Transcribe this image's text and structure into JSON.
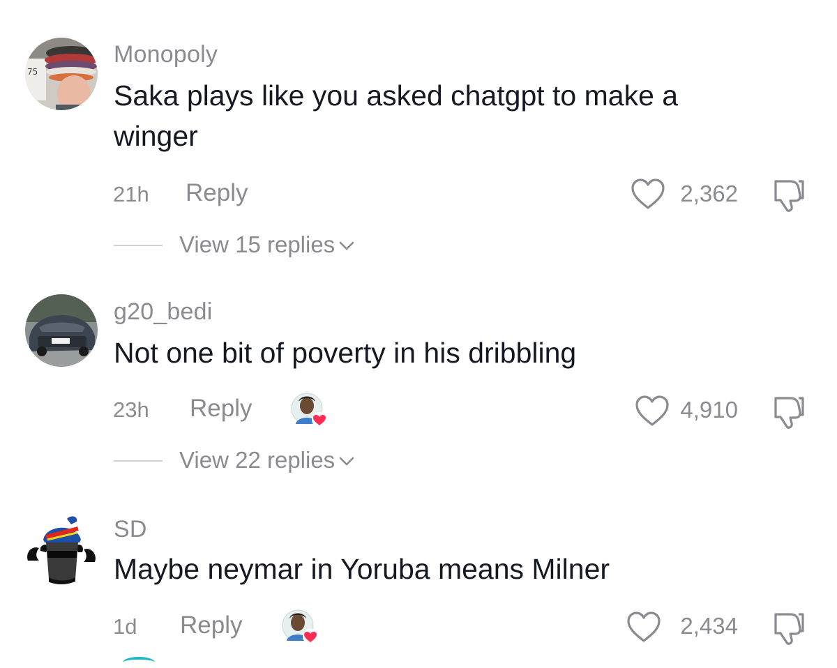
{
  "comments": [
    {
      "username": "Monopoly",
      "text": "Saka plays like you asked chatgpt to make a winger",
      "time": "21h",
      "reply_label": "Reply",
      "likes": "2,362",
      "view_replies": "View 15 replies",
      "creator_liked": false
    },
    {
      "username": "g20_bedi",
      "text": "Not one bit of poverty in his dribbling",
      "time": "23h",
      "reply_label": "Reply",
      "likes": "4,910",
      "view_replies": "View 22 replies",
      "creator_liked": true
    },
    {
      "username": "SD",
      "text": "Maybe neymar in Yoruba means Milner",
      "time": "1d",
      "reply_label": "Reply",
      "likes": "2,434",
      "creator_liked": true
    }
  ],
  "colors": {
    "secondary_text": "#8a8b91",
    "primary_text": "#161823",
    "heart_badge": "#fe2c55"
  },
  "icons": {
    "like": "heart-outline-icon",
    "dislike": "thumbs-down-icon",
    "expand": "chevron-down-icon",
    "creator_liked": "creator-liked-heart-badge"
  }
}
